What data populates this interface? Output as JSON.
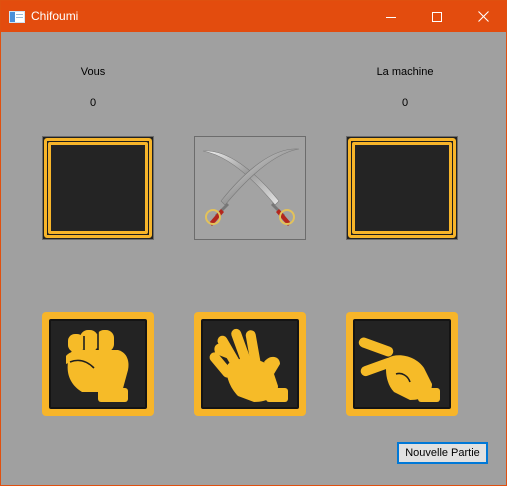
{
  "window": {
    "title": "Chifoumi",
    "accent_color": "#e34c0e",
    "background_color": "#a0a0a0"
  },
  "controls": {
    "minimize_icon": "minimize-icon",
    "maximize_icon": "maximize-icon",
    "close_icon": "close-icon"
  },
  "player": {
    "label": "Vous",
    "score": "0"
  },
  "machine": {
    "label": "La machine",
    "score": "0"
  },
  "choices": [
    {
      "icon": "rock-fist-icon"
    },
    {
      "icon": "paper-hand-icon"
    },
    {
      "icon": "scissors-hand-icon"
    }
  ],
  "versus_icon": "crossed-swords-icon",
  "new_game_button": "Nouvelle Partie",
  "colors": {
    "choice_frame": "#f7b52a",
    "hand": "#f6bb28",
    "panel": "#222222"
  }
}
